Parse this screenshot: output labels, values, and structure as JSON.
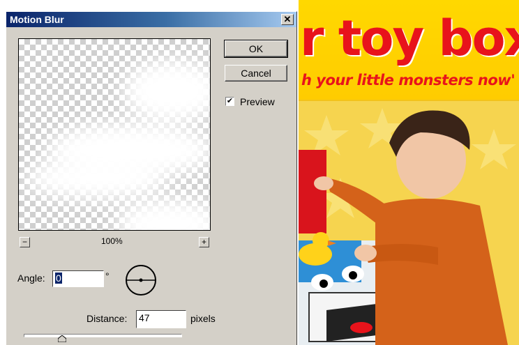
{
  "dialog": {
    "title": "Motion Blur",
    "close_glyph": "✕",
    "ok_label": "OK",
    "cancel_label": "Cancel",
    "preview_label": "Preview",
    "preview_checked": true,
    "zoom_level": "100%",
    "zoom_out_glyph": "−",
    "zoom_in_glyph": "+",
    "angle_label": "Angle:",
    "angle_value": "0",
    "degree_symbol": "°",
    "distance_label": "Distance:",
    "distance_value": "47",
    "distance_unit": "pixels",
    "distance_slider_value": 47
  },
  "background": {
    "headline": "r toy box",
    "tagline": "h your little monsters now'"
  },
  "colors": {
    "dialog_face": "#d4d0c8",
    "titlebar_start": "#0a246a",
    "titlebar_end": "#a6caf0",
    "ad_yellow": "#ffd800",
    "ad_red": "#e8131b"
  }
}
